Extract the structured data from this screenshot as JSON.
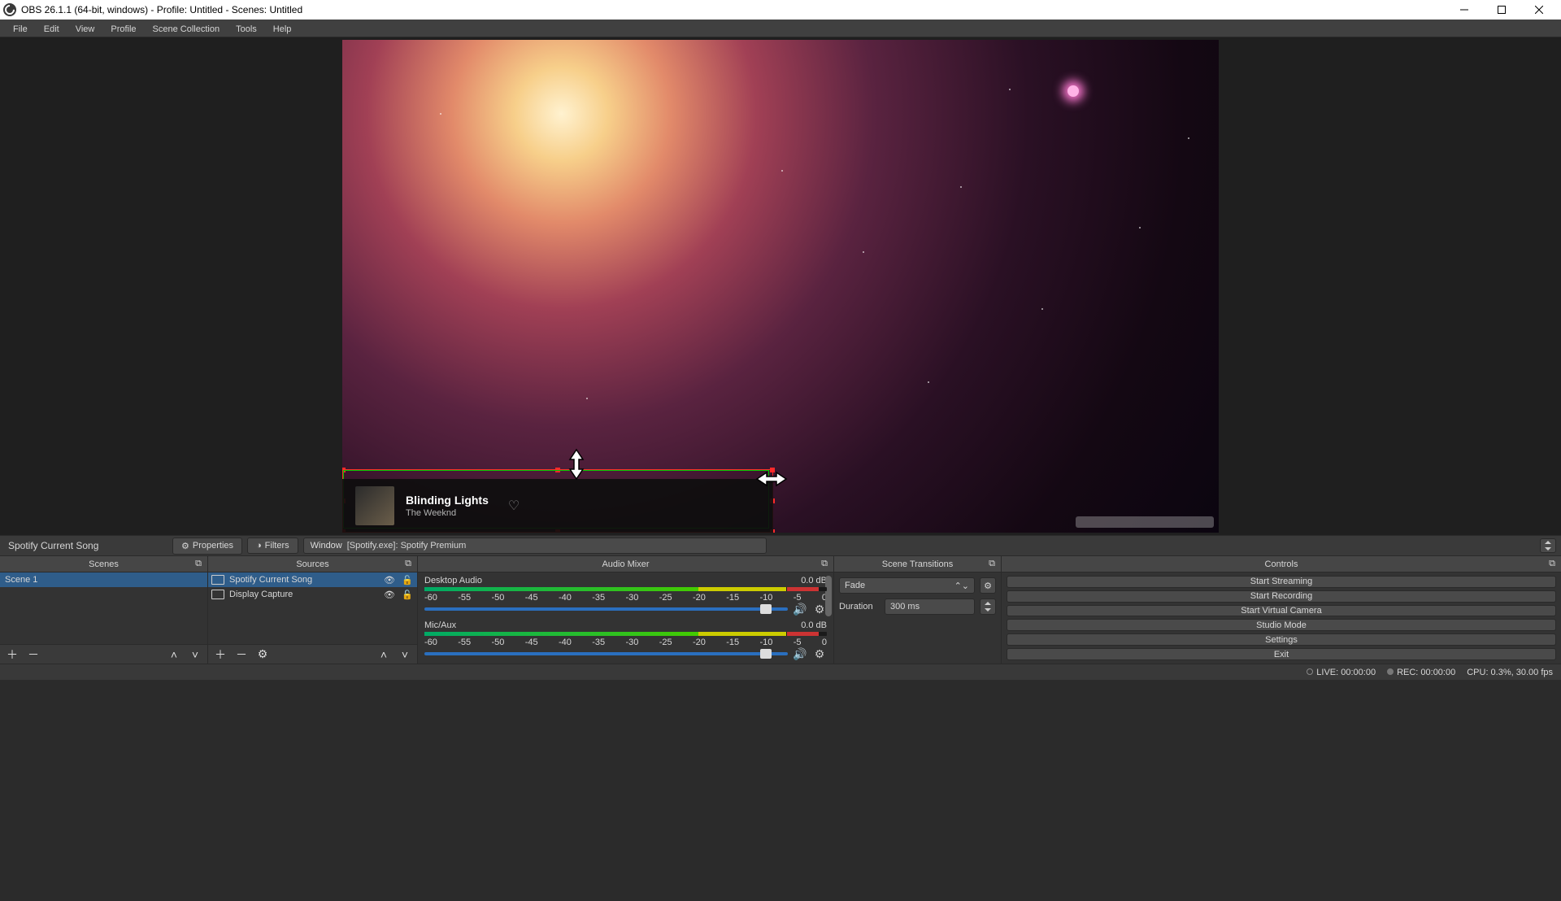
{
  "window": {
    "title": "OBS 26.1.1 (64-bit, windows) - Profile: Untitled - Scenes: Untitled"
  },
  "menubar": {
    "file": "File",
    "edit": "Edit",
    "view": "View",
    "profile": "Profile",
    "scene_collection": "Scene Collection",
    "tools": "Tools",
    "help": "Help"
  },
  "overlay_song": {
    "title": "Blinding Lights",
    "artist": "The Weeknd"
  },
  "source_info": {
    "selected_source": "Spotify Current Song",
    "properties_label": "Properties",
    "filters_label": "Filters",
    "window_label": "Window",
    "window_value": "[Spotify.exe]: Spotify Premium"
  },
  "docks": {
    "scenes": {
      "title": "Scenes",
      "items": [
        "Scene 1"
      ]
    },
    "sources": {
      "title": "Sources",
      "items": [
        {
          "label": "Spotify Current Song",
          "icon": "window-icon"
        },
        {
          "label": "Display Capture",
          "icon": "display-icon"
        }
      ]
    },
    "mixer": {
      "title": "Audio Mixer",
      "channels": [
        {
          "name": "Desktop Audio",
          "level": "0.0 dB"
        },
        {
          "name": "Mic/Aux",
          "level": "0.0 dB"
        }
      ],
      "ticks": [
        "-60",
        "-55",
        "-50",
        "-45",
        "-40",
        "-35",
        "-30",
        "-25",
        "-20",
        "-15",
        "-10",
        "-5",
        "0"
      ]
    },
    "transitions": {
      "title": "Scene Transitions",
      "selected": "Fade",
      "duration_label": "Duration",
      "duration_value": "300 ms"
    },
    "controls": {
      "title": "Controls",
      "buttons": [
        "Start Streaming",
        "Start Recording",
        "Start Virtual Camera",
        "Studio Mode",
        "Settings",
        "Exit"
      ]
    }
  },
  "statusbar": {
    "live": "LIVE: 00:00:00",
    "rec": "REC: 00:00:00",
    "cpu": "CPU: 0.3%, 30.00 fps"
  }
}
